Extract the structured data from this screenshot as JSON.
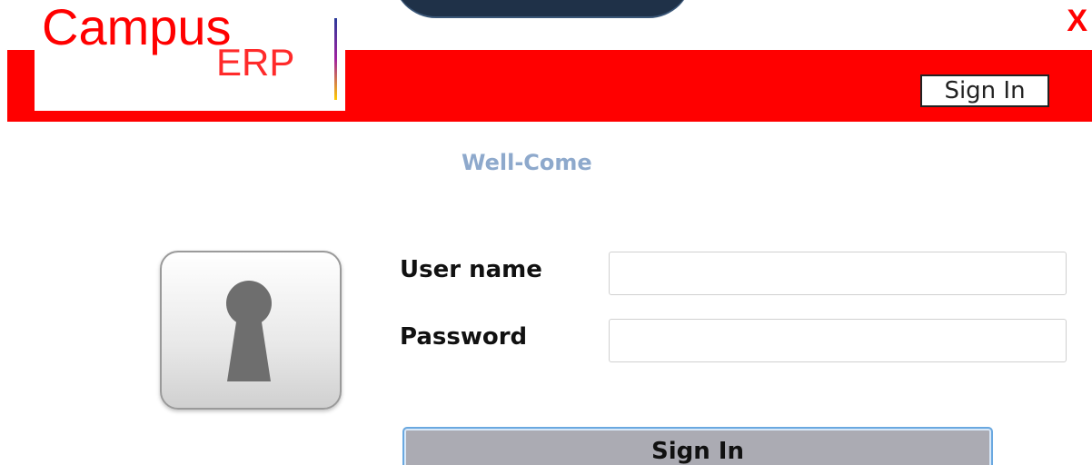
{
  "logo": {
    "campus": "Campus",
    "erp": "ERP"
  },
  "header": {
    "close_label": "X",
    "signin_label": "Sign In"
  },
  "welcome": "Well-Come",
  "form": {
    "username_label": "User name",
    "username_value": "",
    "password_label": "Password",
    "password_value": "",
    "submit_label": "Sign In"
  },
  "icons": {
    "keyhole": "keyhole-icon",
    "close": "close-icon"
  },
  "colors": {
    "header": "#ff0000",
    "welcome": "#8ea9cc",
    "button": "#ababb3"
  }
}
